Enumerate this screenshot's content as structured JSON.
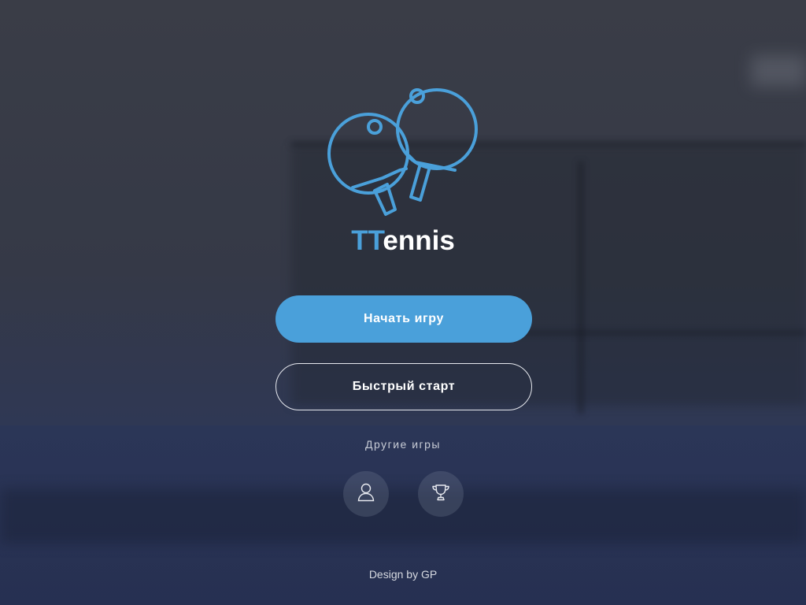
{
  "app": {
    "title_accent": "TT",
    "title_rest": "ennis"
  },
  "buttons": {
    "start_game": "Начать игру",
    "quick_start": "Быстрый старт"
  },
  "other_games_label": "Другие игры",
  "icon_buttons": [
    {
      "icon": "user-icon"
    },
    {
      "icon": "trophy-icon"
    }
  ],
  "footer": {
    "credit": "Design by GP"
  },
  "colors": {
    "accent": "#4aa0da",
    "background": "#2c3140"
  }
}
